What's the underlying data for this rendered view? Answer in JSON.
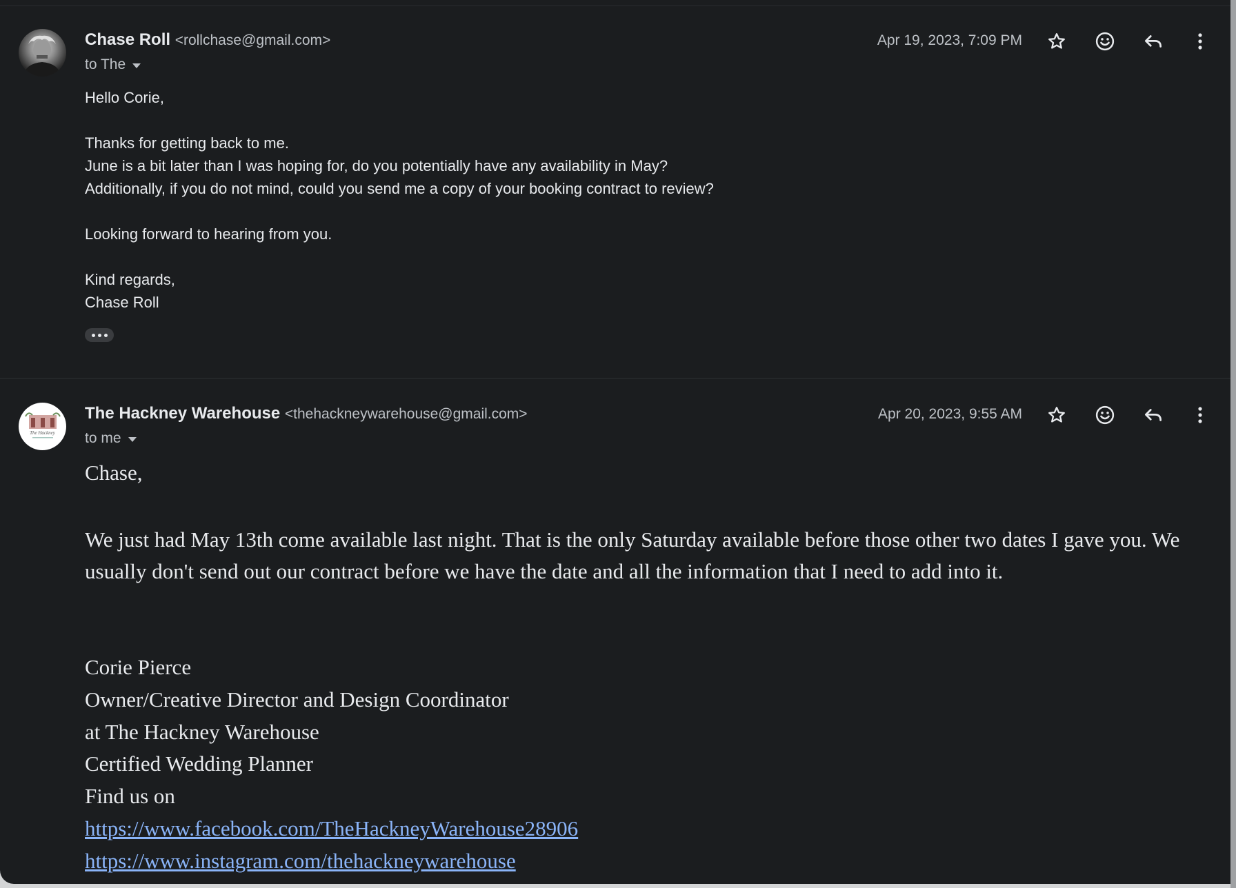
{
  "messages": [
    {
      "sender_name": "Chase Roll",
      "sender_email": "<rollchase@gmail.com>",
      "recipient": "to The",
      "date": "Apr 19, 2023, 7:09 PM",
      "avatar_icon": "person-photo-icon",
      "body": {
        "greeting": "Hello Corie,",
        "line1": "Thanks for getting back to me.",
        "line2": "June is a bit later than I was hoping for, do you potentially have any availability in May?",
        "line3": "Additionally, if you do not mind, could you send me a copy of your booking contract to review?",
        "line4": "Looking forward to hearing from you.",
        "closing": "Kind regards,",
        "signature": "Chase Roll"
      }
    },
    {
      "sender_name": "The Hackney Warehouse",
      "sender_email": "<thehackneywarehouse@gmail.com>",
      "recipient": "to me",
      "date": "Apr 20, 2023, 9:55 AM",
      "avatar_icon": "hackney-logo-icon",
      "avatar_logo_text": "The Hackney",
      "body": {
        "greeting": "Chase,",
        "paragraph": "We just had May 13th come available last night.  That is the only Saturday available before those other two dates I gave you.  We usually don't send out our contract before we have the date and all the information that I need to add into it.",
        "sig_name": "Corie Pierce",
        "sig_title": "Owner/Creative Director and Design Coordinator",
        "sig_company": "at The Hackney Warehouse",
        "sig_cert": "Certified Wedding Planner",
        "sig_find": "Find us on",
        "link_facebook": "https://www.facebook.com/TheHackneyWarehouse28906",
        "link_instagram": "https://www.instagram.com/thehackneywarehouse"
      }
    }
  ],
  "icons": {
    "star": "star-icon",
    "emoji": "emoji-react-icon",
    "reply": "reply-icon",
    "more": "more-vert-icon",
    "expand": "show-trimmed-content-icon",
    "details": "chevron-down-icon"
  },
  "colors": {
    "background": "#1b1d1f",
    "text": "#e8eaed",
    "secondary_text": "#bdc1c6",
    "link": "#8ab4f8"
  }
}
